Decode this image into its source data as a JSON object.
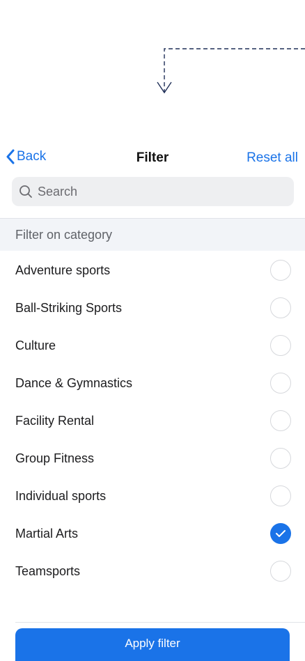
{
  "colors": {
    "accent": "#1a73e8",
    "section_bg": "#f2f4f8",
    "search_bg": "#eeeff1",
    "annotation": "#1f2f57"
  },
  "annotation": {
    "icon": "dashed-arrow-down-icon"
  },
  "navbar": {
    "back_label": "Back",
    "back_icon": "chevron-left-icon",
    "title": "Filter",
    "reset_label": "Reset all"
  },
  "search": {
    "placeholder": "Search",
    "value": "",
    "icon": "search-icon"
  },
  "section": {
    "title": "Filter on category"
  },
  "categories": [
    {
      "label": "Adventure sports",
      "selected": false
    },
    {
      "label": "Ball-Striking Sports",
      "selected": false
    },
    {
      "label": "Culture",
      "selected": false
    },
    {
      "label": "Dance & Gymnastics",
      "selected": false
    },
    {
      "label": "Facility Rental",
      "selected": false
    },
    {
      "label": "Group Fitness",
      "selected": false
    },
    {
      "label": "Individual sports",
      "selected": false
    },
    {
      "label": "Martial Arts",
      "selected": true
    },
    {
      "label": "Teamsports",
      "selected": false
    }
  ],
  "footer": {
    "apply_label": "Apply filter"
  }
}
